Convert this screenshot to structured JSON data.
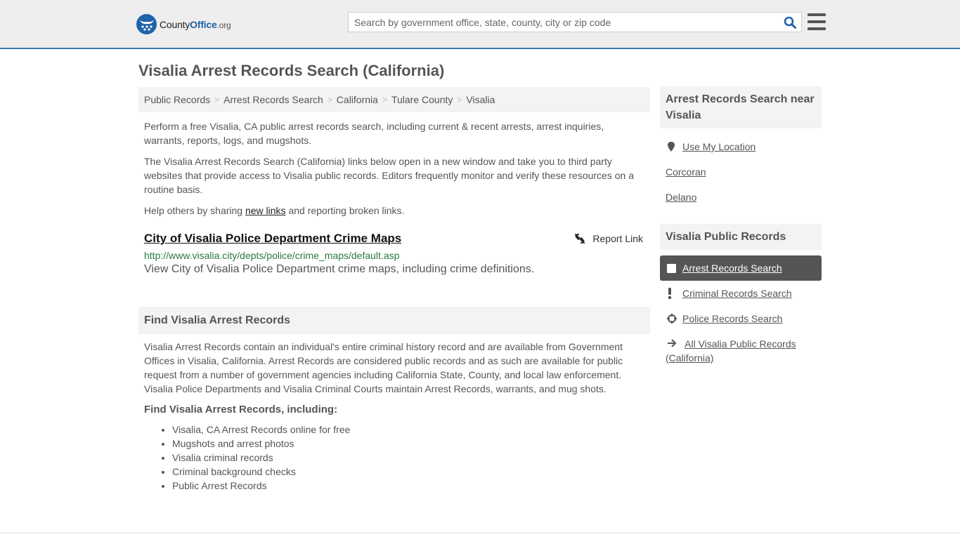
{
  "header": {
    "logo": {
      "county": "County",
      "office": "Office",
      "org": ".org"
    },
    "search": {
      "placeholder": "Search by government office, state, county, city or zip code",
      "value": ""
    },
    "search_icon": "search-icon",
    "menu_icon": "hamburger-menu-icon"
  },
  "page": {
    "title": "Visalia Arrest Records Search (California)"
  },
  "breadcrumb": [
    {
      "label": "Public Records"
    },
    {
      "label": "Arrest Records Search"
    },
    {
      "label": "California"
    },
    {
      "label": "Tulare County"
    },
    {
      "label": "Visalia"
    }
  ],
  "intro": {
    "p1": "Perform a free Visalia, CA public arrest records search, including current & recent arrests, arrest inquiries, warrants, reports, logs, and mugshots.",
    "p2": "The Visalia Arrest Records Search (California) links below open in a new window and take you to third party websites that provide access to Visalia public records. Editors frequently monitor and verify these resources on a routine basis.",
    "p3_before": "Help others by sharing ",
    "p3_link": "new links",
    "p3_after": " and reporting broken links."
  },
  "results": [
    {
      "title": "City of Visalia Police Department Crime Maps",
      "url": "http://www.visalia.city/depts/police/crime_maps/default.asp",
      "description": "View City of Visalia Police Department crime maps, including crime definitions.",
      "report_label": "Report Link"
    }
  ],
  "find_section": {
    "heading": "Find Visalia Arrest Records",
    "body": "Visalia Arrest Records contain an individual's entire criminal history record and are available from Government Offices in Visalia, California. Arrest Records are considered public records and as such are available for public request from a number of government agencies including California State, County, and local law enforcement. Visalia Police Departments and Visalia Criminal Courts maintain Arrest Records, warrants, and mug shots.",
    "subheading": "Find Visalia Arrest Records, including:",
    "bullets": [
      "Visalia, CA Arrest Records online for free",
      "Mugshots and arrest photos",
      "Visalia criminal records",
      "Criminal background checks",
      "Public Arrest Records"
    ]
  },
  "sidebar": {
    "nearby_heading": "Arrest Records Search near Visalia",
    "nearby": [
      {
        "label": "Use My Location",
        "icon": "map-marker-icon"
      },
      {
        "label": "Corcoran"
      },
      {
        "label": "Delano"
      }
    ],
    "records_heading": "Visalia Public Records",
    "records": [
      {
        "label": "Arrest Records Search",
        "icon": "square-icon",
        "active": true
      },
      {
        "label": "Criminal Records Search",
        "icon": "exclamation-icon"
      },
      {
        "label": "Police Records Search",
        "icon": "crosshair-icon"
      },
      {
        "label": "All Visalia Public Records (California)",
        "icon": "arrow-right-icon"
      }
    ]
  }
}
